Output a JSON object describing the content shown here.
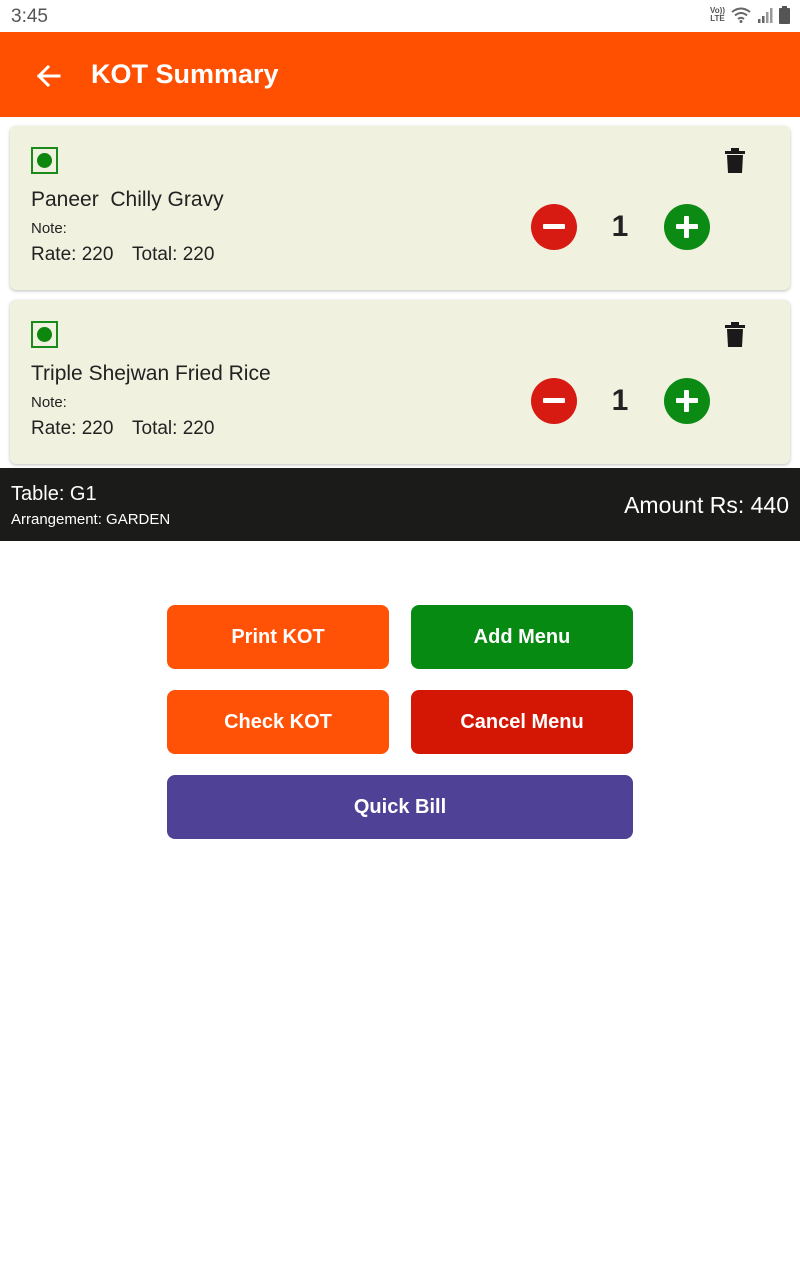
{
  "status_bar": {
    "time": "3:45",
    "volte_top": "Vo))",
    "volte_bottom": "LTE"
  },
  "app_bar": {
    "title": "KOT Summary"
  },
  "items": [
    {
      "name": "Paneer  Chilly Gravy",
      "note": "Note:",
      "rate": "Rate: 220",
      "total": "Total: 220",
      "qty": "1"
    },
    {
      "name": "Triple Shejwan Fried Rice",
      "note": "Note:",
      "rate": "Rate: 220",
      "total": "Total: 220",
      "qty": "1"
    }
  ],
  "summary": {
    "table": "Table: G1",
    "arrangement": "Arrangement: GARDEN",
    "amount": "Amount Rs: 440"
  },
  "buttons": {
    "print_kot": "Print KOT",
    "add_menu": "Add Menu",
    "check_kot": "Check KOT",
    "cancel_menu": "Cancel Menu",
    "quick_bill": "Quick Bill"
  },
  "colors": {
    "primary": "#ff4f00",
    "add": "#078a12",
    "cancel": "#d41605",
    "quick_bill": "#4f4296",
    "card_bg": "#f0f1df",
    "summary_bg": "#1b1c1a"
  }
}
